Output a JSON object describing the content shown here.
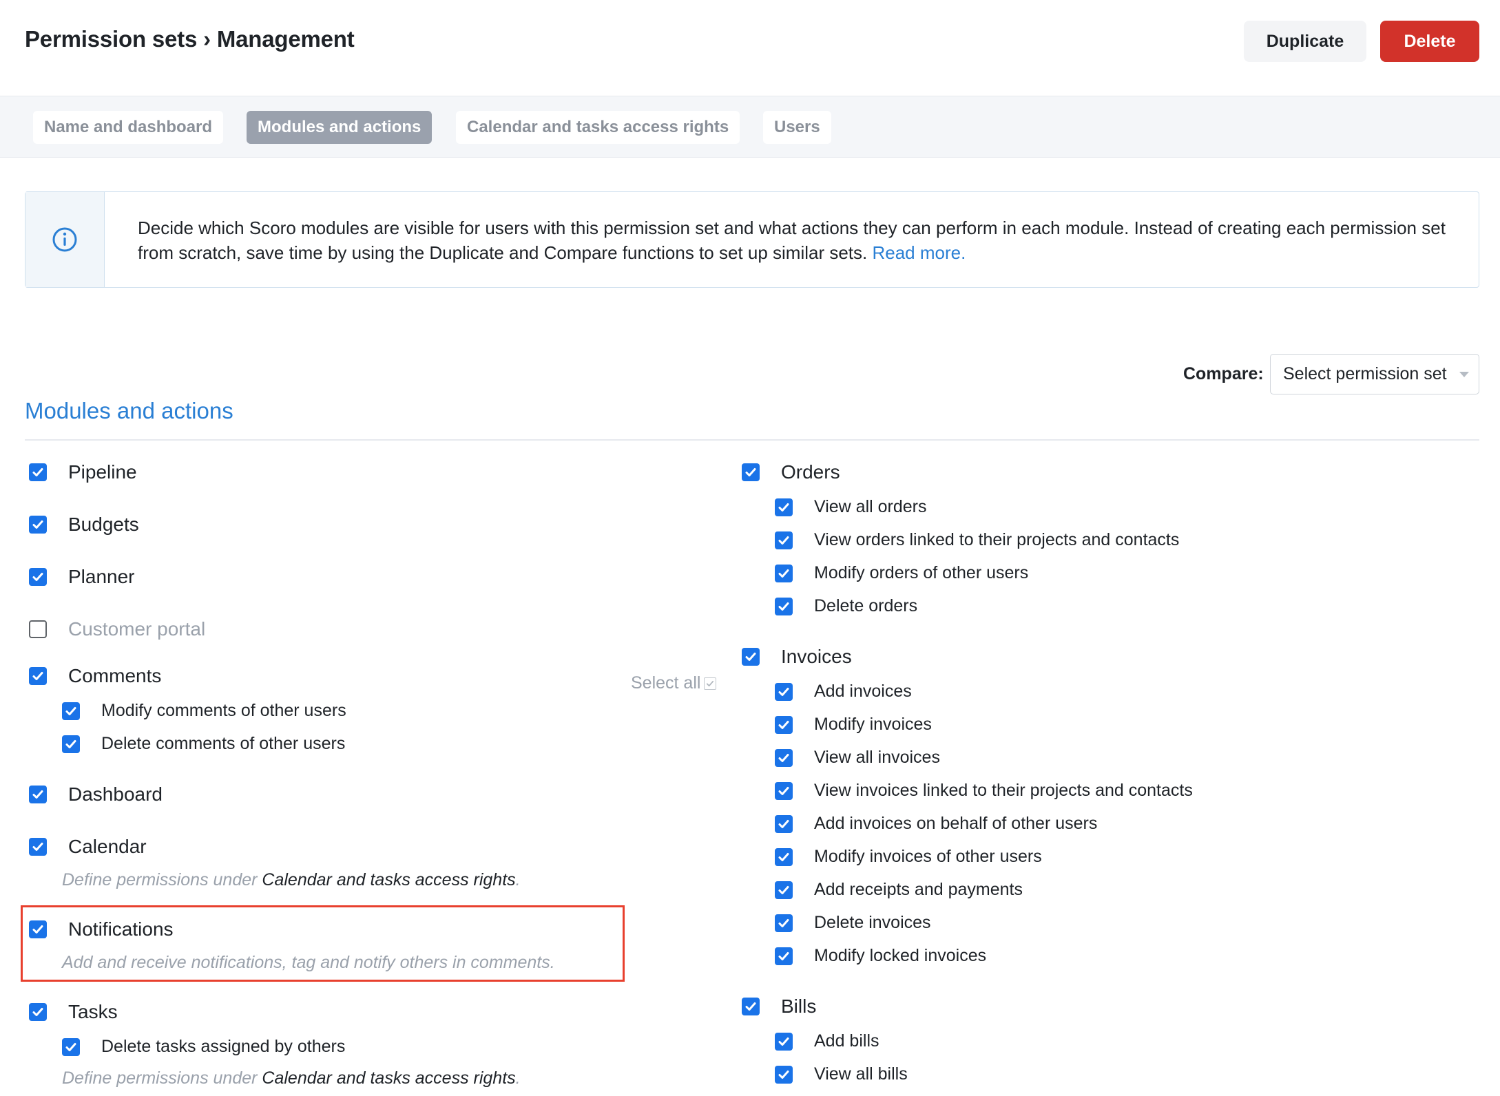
{
  "header": {
    "title": "Permission sets › Management",
    "duplicate_label": "Duplicate",
    "delete_label": "Delete",
    "delete_color": "#d2322a"
  },
  "tabs": [
    {
      "label": "Name and dashboard",
      "active": false
    },
    {
      "label": "Modules and actions",
      "active": true
    },
    {
      "label": "Calendar and tasks access rights",
      "active": false
    },
    {
      "label": "Users",
      "active": false
    }
  ],
  "info": {
    "icon": "info-icon",
    "text": "Decide which Scoro modules are visible for users with this permission set and what actions they can perform in each module. Instead of creating each permission set from scratch, save time by using the Duplicate and Compare functions to set up similar sets.",
    "link": "Read more."
  },
  "compare": {
    "label": "Compare:",
    "placeholder": "Select permission set"
  },
  "section": {
    "title": "Modules and actions",
    "accent": "#2a7fd4"
  },
  "select_all": "Select all",
  "left_column": {
    "pipeline": {
      "label": "Pipeline",
      "checked": true
    },
    "budgets": {
      "label": "Budgets",
      "checked": true
    },
    "planner": {
      "label": "Planner",
      "checked": true
    },
    "customer_portal": {
      "label": "Customer portal",
      "checked": false
    },
    "comments": {
      "label": "Comments",
      "checked": true,
      "actions": [
        {
          "label": "Modify comments of other users",
          "checked": true
        },
        {
          "label": "Delete comments of other users",
          "checked": true
        }
      ]
    },
    "dashboard": {
      "label": "Dashboard",
      "checked": true
    },
    "calendar": {
      "label": "Calendar",
      "checked": true,
      "note_prefix": "Define permissions under ",
      "note_link": "Calendar and tasks access rights",
      "note_suffix": "."
    },
    "notifications": {
      "label": "Notifications",
      "checked": true,
      "note": "Add and receive notifications, tag and notify others in comments."
    },
    "tasks": {
      "label": "Tasks",
      "checked": true,
      "actions": [
        {
          "label": "Delete tasks assigned by others",
          "checked": true
        }
      ],
      "note_prefix": "Define permissions under ",
      "note_link": "Calendar and tasks access rights",
      "note_suffix": "."
    }
  },
  "right_column": {
    "orders": {
      "label": "Orders",
      "checked": true,
      "actions": [
        {
          "label": "View all orders",
          "checked": true
        },
        {
          "label": "View orders linked to their projects and contacts",
          "checked": true
        },
        {
          "label": "Modify orders of other users",
          "checked": true
        },
        {
          "label": "Delete orders",
          "checked": true
        }
      ]
    },
    "invoices": {
      "label": "Invoices",
      "checked": true,
      "actions": [
        {
          "label": "Add invoices",
          "checked": true
        },
        {
          "label": "Modify invoices",
          "checked": true
        },
        {
          "label": "View all invoices",
          "checked": true
        },
        {
          "label": "View invoices linked to their projects and contacts",
          "checked": true
        },
        {
          "label": "Add invoices on behalf of other users",
          "checked": true
        },
        {
          "label": "Modify invoices of other users",
          "checked": true
        },
        {
          "label": "Add receipts and payments",
          "checked": true
        },
        {
          "label": "Delete invoices",
          "checked": true
        },
        {
          "label": "Modify locked invoices",
          "checked": true
        }
      ]
    },
    "bills": {
      "label": "Bills",
      "checked": true,
      "actions": [
        {
          "label": "Add bills",
          "checked": true
        },
        {
          "label": "View all bills",
          "checked": true
        }
      ]
    }
  }
}
